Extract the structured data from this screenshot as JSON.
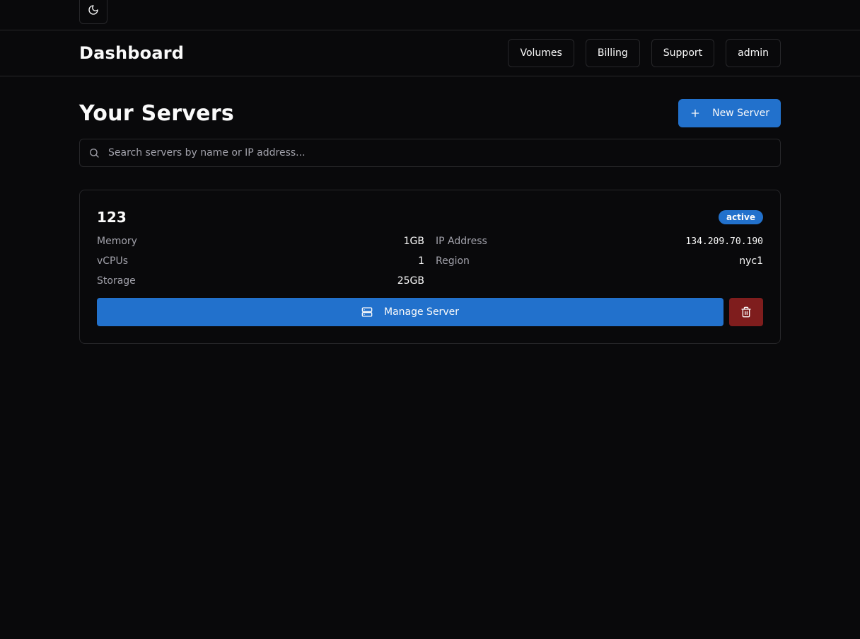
{
  "theme_toggle": {
    "icon": "moon-icon"
  },
  "header": {
    "brand": "Dashboard",
    "nav": [
      {
        "label": "Volumes"
      },
      {
        "label": "Billing"
      },
      {
        "label": "Support"
      },
      {
        "label": "admin"
      }
    ]
  },
  "main": {
    "title": "Your Servers",
    "new_server_label": "New Server",
    "new_server_icon": "plus-icon",
    "search": {
      "placeholder": "Search servers by name or IP address...",
      "value": "",
      "icon": "search-icon"
    }
  },
  "servers": [
    {
      "name": "123",
      "status": "active",
      "specs_left": [
        {
          "label": "Memory",
          "value": "1GB"
        },
        {
          "label": "vCPUs",
          "value": "1"
        },
        {
          "label": "Storage",
          "value": "25GB"
        }
      ],
      "specs_right": [
        {
          "label": "IP Address",
          "value": "134.209.70.190"
        },
        {
          "label": "Region",
          "value": "nyc1"
        }
      ],
      "manage_label": "Manage Server",
      "manage_icon": "server-icon",
      "delete_icon": "trash-icon"
    }
  ],
  "colors": {
    "background": "#09090b",
    "border": "#27272a",
    "primary": "#2271cc",
    "danger": "#7f1d1d",
    "muted_text": "#a1a1aa"
  }
}
